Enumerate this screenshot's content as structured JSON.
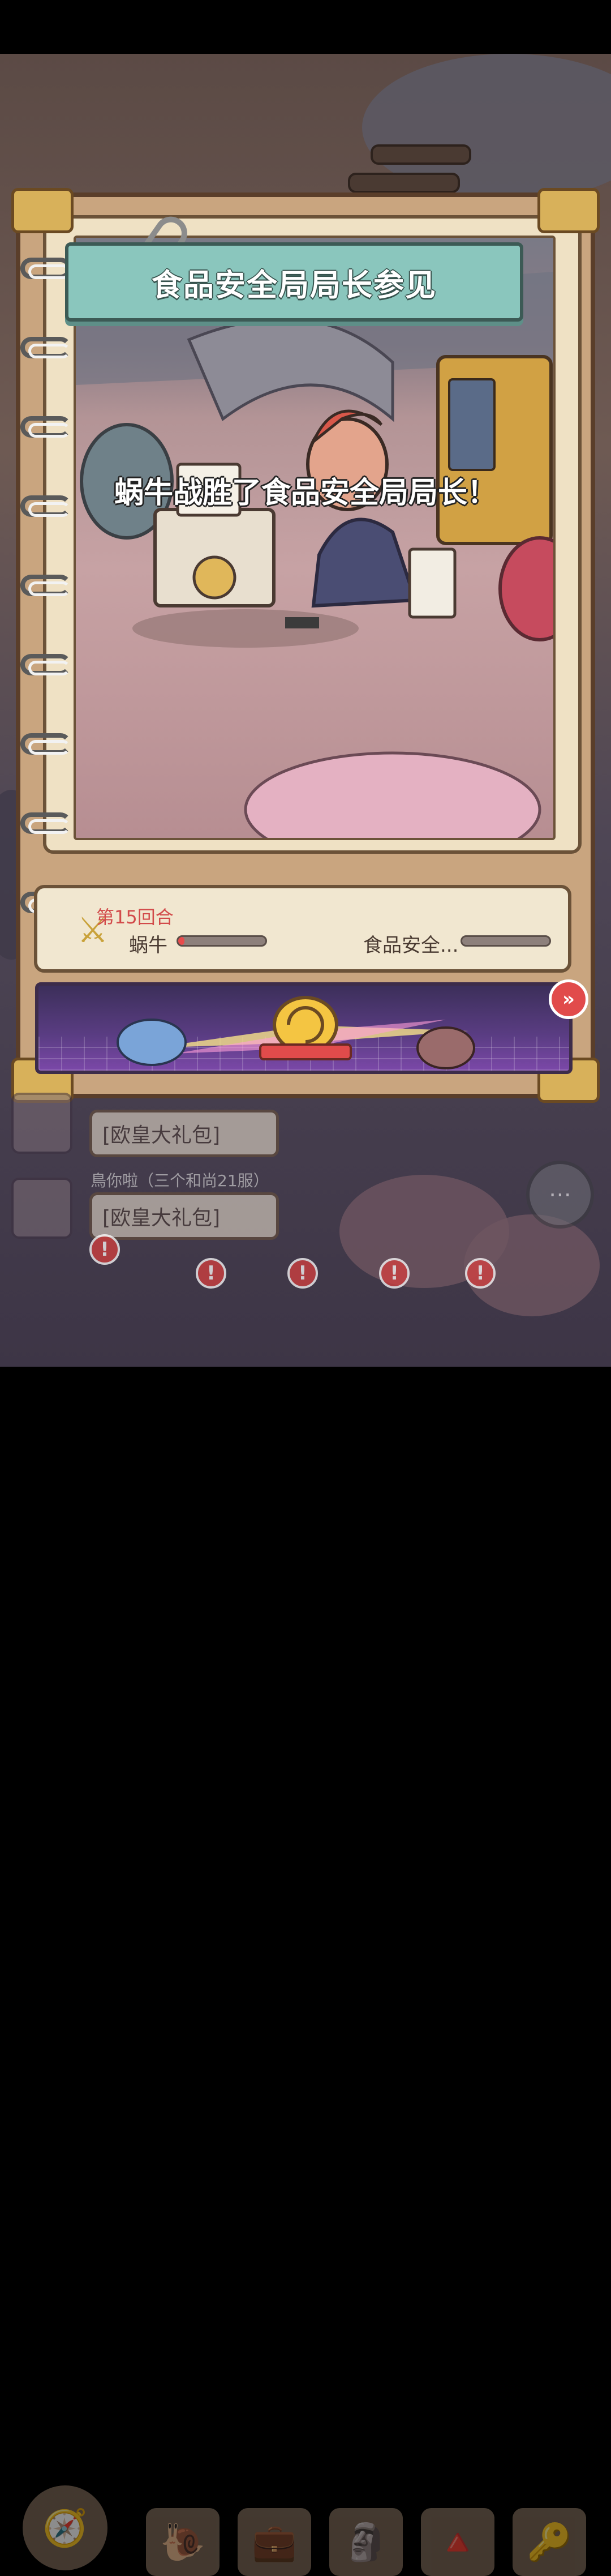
{
  "dialog": {
    "title": "食品安全局局长参见",
    "result_message": "蜗牛战胜了食品安全局局长！",
    "round_label": "第15回合",
    "player": {
      "name": "蜗牛",
      "hp_fraction": 0.04
    },
    "enemy": {
      "name": "食品安全...",
      "hp_fraction": 0.0
    },
    "skip_icon": "fast-forward-icon"
  },
  "chat": {
    "messages": [
      {
        "text": "[欧皇大礼包]"
      },
      {
        "sender": "鳥你啦（三个和尚21服）",
        "text": "[欧皇大礼包]"
      }
    ]
  },
  "bottom_nav": {
    "icons": [
      "compass-icon",
      "snail-icon",
      "briefcase-icon",
      "statue-icon",
      "pyramid-icon",
      "key-icon"
    ],
    "badge": "!"
  },
  "colors": {
    "banner": "#8ac6bd",
    "alert": "#e14b4b",
    "round_text": "#d24a4a"
  }
}
